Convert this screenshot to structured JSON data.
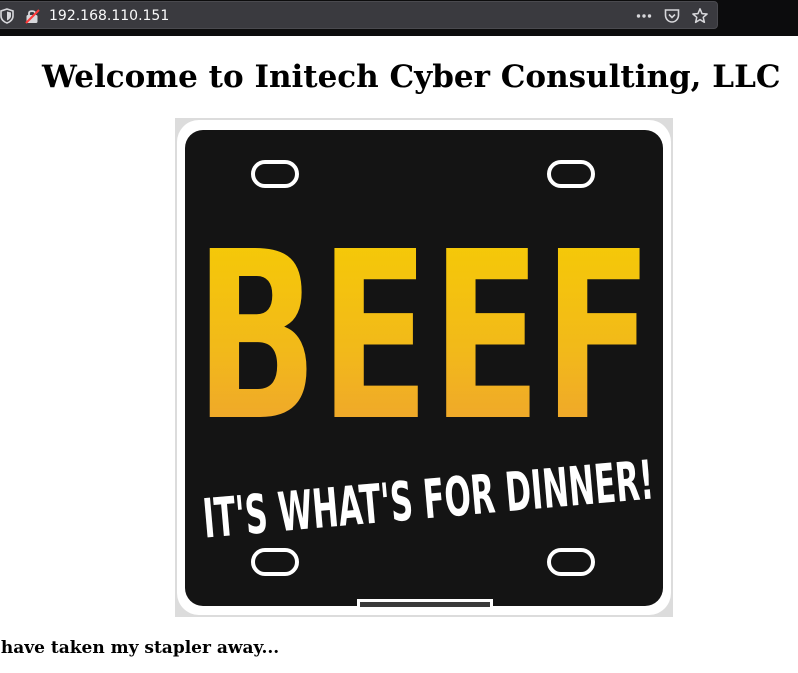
{
  "browser": {
    "url": "192.168.110.151",
    "icons": {
      "tracking": "shield-icon",
      "security": "insecure-lock-icon",
      "menu": "more-dots-icon",
      "pocket": "pocket-icon",
      "bookmark": "star-icon"
    }
  },
  "page": {
    "title": "Welcome to Initech Cyber Consulting, LLC",
    "image": {
      "big_text": "BEEF",
      "sub_text": "IT'S WHAT'S FOR DINNER!",
      "colors": {
        "plate": "#141414",
        "border": "#ffffff",
        "beef_top": "#f2c500",
        "beef_bottom": "#f0a030",
        "slogan": "#ffffff"
      }
    },
    "caption": "I have taken my stapler away..."
  }
}
